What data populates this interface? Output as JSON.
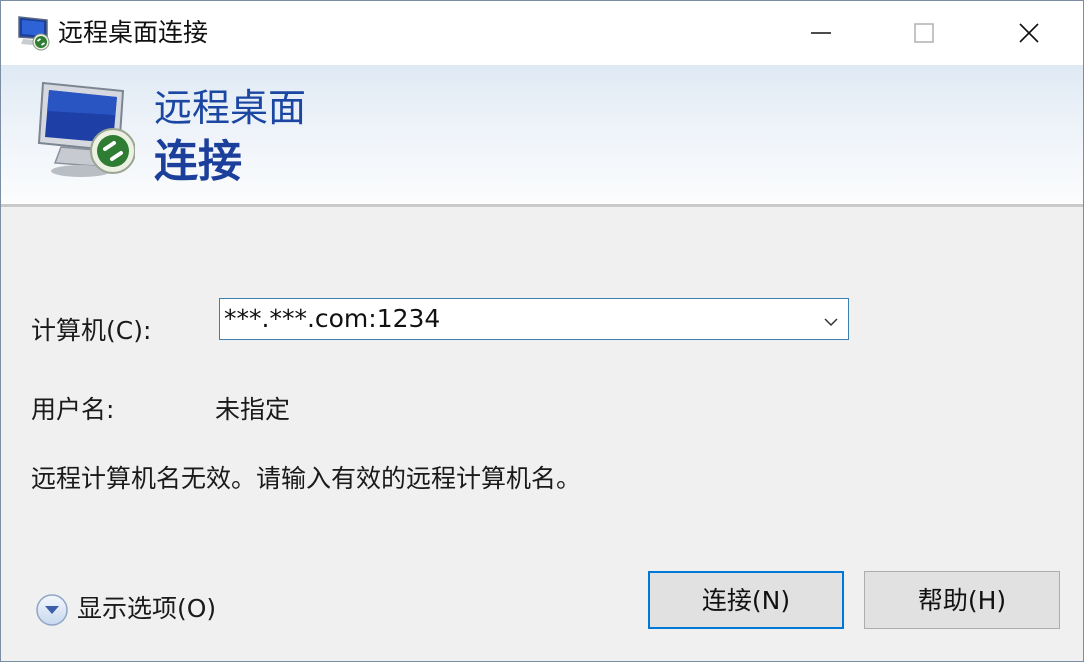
{
  "window": {
    "title": "远程桌面连接",
    "icon": "remote-desktop-icon",
    "controls": [
      "minimize-icon",
      "maximize-icon",
      "close-icon"
    ]
  },
  "banner": {
    "line1": "远程桌面",
    "line2": "连接",
    "icon": "monitor-remote-icon"
  },
  "form": {
    "computer_label": "计算机(C):",
    "computer_value": "***.***.com:1234",
    "username_label": "用户名:",
    "username_value": "未指定",
    "error_message": "远程计算机名无效。请输入有效的远程计算机名。"
  },
  "footer": {
    "show_options_label": "显示选项(O)",
    "connect_label": "连接(N)",
    "help_label": "帮助(H)"
  },
  "colors": {
    "accent": "#0078d7",
    "banner_text": "#1b47a3",
    "dialog_bg": "#f0f0f0"
  }
}
